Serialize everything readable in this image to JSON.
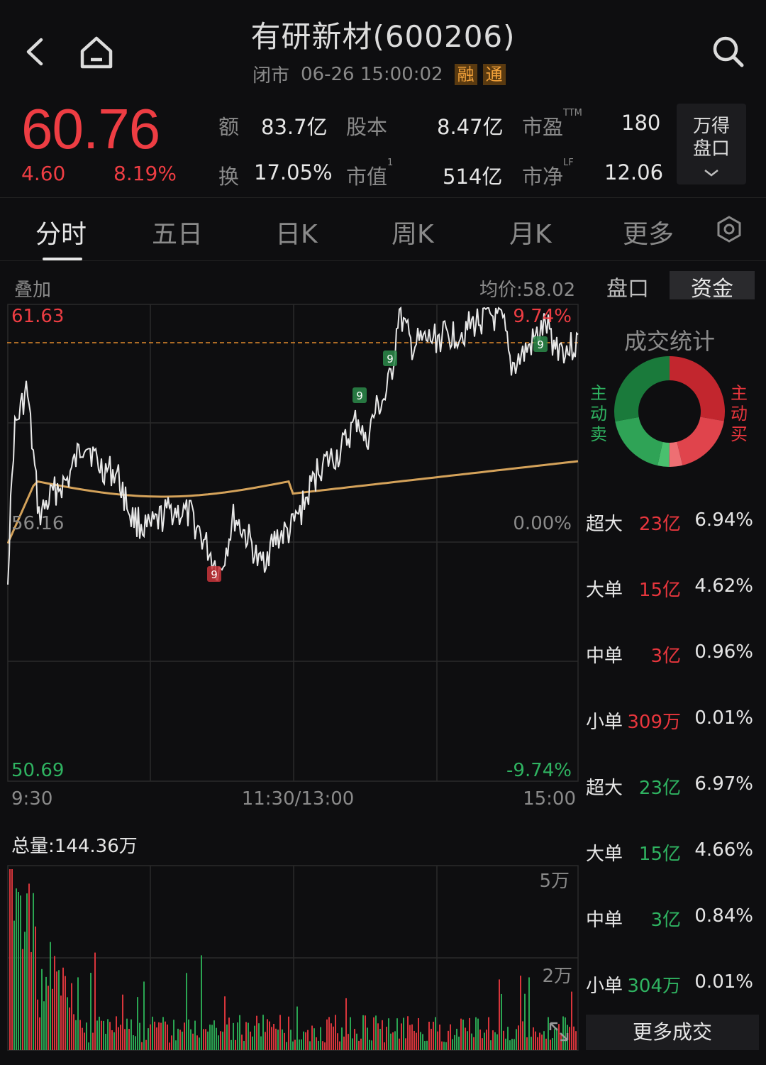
{
  "header": {
    "title": "有研新材(600206)",
    "status": "闭市",
    "datetime": "06-26 15:00:02",
    "tags": [
      "融",
      "通"
    ]
  },
  "quote": {
    "price": "60.76",
    "change": "4.60",
    "change_pct": "8.19%",
    "colors": {
      "up": "#ee3d43",
      "down": "#2fb361"
    },
    "stats": [
      {
        "label": "额",
        "value": "83.7亿"
      },
      {
        "label": "股本",
        "value": "8.47亿"
      },
      {
        "label": "市盈",
        "sup": "TTM",
        "value": "180"
      },
      {
        "label": "换",
        "value": "17.05%"
      },
      {
        "label": "市值",
        "sup": "1",
        "value": "514亿"
      },
      {
        "label": "市净",
        "sup": "LF",
        "value": "12.06"
      }
    ],
    "wind_button": [
      "万得",
      "盘口"
    ]
  },
  "tabs": [
    "分时",
    "五日",
    "日K",
    "周K",
    "月K",
    "更多"
  ],
  "active_tab": 0,
  "intraday": {
    "overlay_label": "叠加",
    "avg_price_label": "均价:58.02",
    "high": "61.63",
    "low": "50.69",
    "base": "56.16",
    "pct_high": "9.74%",
    "pct_zero": "0.00%",
    "pct_low": "-9.74%",
    "time_labels": [
      "9:30",
      "11:30/13:00",
      "15:00"
    ],
    "signal_marker": "9"
  },
  "volume": {
    "total_label": "总量:144.36万",
    "ticks": [
      "5万",
      "2万"
    ]
  },
  "side_tabs": [
    "盘口",
    "资金"
  ],
  "side_active": 1,
  "stats": {
    "title": "成交统计",
    "sell_label": "主动卖",
    "buy_label": "主动买",
    "buy_rows": [
      {
        "label": "超大",
        "amount": "23亿",
        "pct": "6.94%"
      },
      {
        "label": "大单",
        "amount": "15亿",
        "pct": "4.62%"
      },
      {
        "label": "中单",
        "amount": "3亿",
        "pct": "0.96%"
      },
      {
        "label": "小单",
        "amount": "309万",
        "pct": "0.01%"
      }
    ],
    "sell_rows": [
      {
        "label": "超大",
        "amount": "23亿",
        "pct": "6.97%"
      },
      {
        "label": "大单",
        "amount": "15亿",
        "pct": "4.66%"
      },
      {
        "label": "中单",
        "amount": "3亿",
        "pct": "0.84%"
      },
      {
        "label": "小单",
        "amount": "304万",
        "pct": "0.01%"
      }
    ],
    "more_button": "更多成交"
  }
}
